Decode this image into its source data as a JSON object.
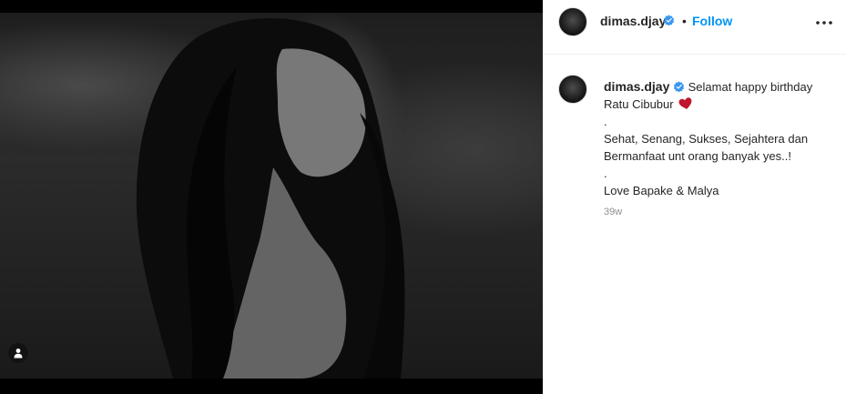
{
  "post": {
    "username": "dimas.djay",
    "follow_label": "Follow",
    "separator": "•",
    "caption": {
      "first_text": "Selamat happy birthday",
      "second_text": "Ratu Cibubur",
      "lines": [
        ".",
        "Sehat, Senang, Sukses, Sejahtera dan",
        "Bermanfaat unt orang banyak yes..!",
        ".",
        "Love Bapake & Malya"
      ]
    },
    "timestamp": "39w"
  },
  "icons": {
    "verified": "verified-badge-icon",
    "more": "more-options-icon",
    "user_tag": "user-tag-icon",
    "heart": "red-heart-emoji-icon"
  },
  "colors": {
    "follow": "#0095f6",
    "verified": "#3897f0",
    "heart": "#c0152e",
    "timestamp": "#8e8e8e"
  }
}
